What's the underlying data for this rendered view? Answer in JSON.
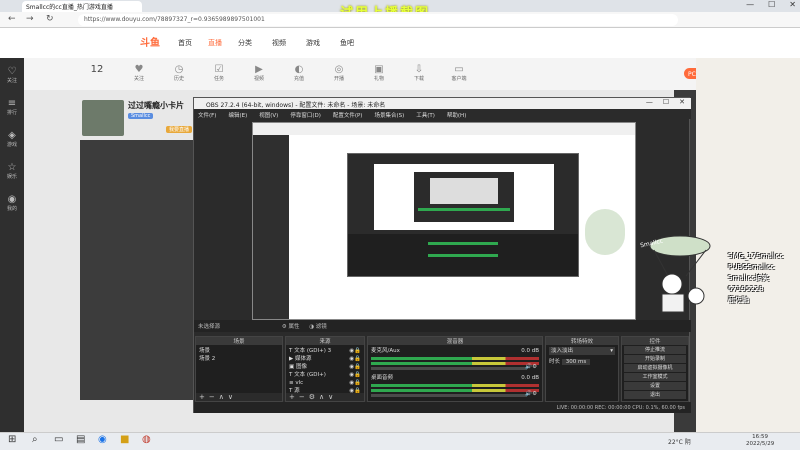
{
  "browser": {
    "tab_title": "Smallcc的cc直播_热门游戏直播",
    "url": "https://www.douyu.com/78897327_r=0.9365989897501001",
    "overlay_text": "试用上播截图"
  },
  "site": {
    "logo": "斗鱼",
    "nav": [
      "首页",
      "直播",
      "分类",
      "视频",
      "游戏",
      "鱼吧"
    ],
    "toolbar": [
      "12",
      "关注",
      "历史",
      "任务",
      "视频",
      "充值",
      "开播",
      "礼物",
      "下载",
      "客户端"
    ],
    "pc_client": "PC客户端",
    "room_title": "过过嘴瘾小卡片",
    "badges": [
      "Smallcc",
      "我要直播"
    ],
    "rail": [
      "关注",
      "排行",
      "游戏",
      "娱乐",
      "我的"
    ]
  },
  "obs": {
    "title": "OBS 27.2.4 (64-bit, windows) - 配置文件: 未命名 - 场景: 未命名",
    "menu": [
      "文件(F)",
      "编辑(E)",
      "视图(V)",
      "停靠窗口(D)",
      "配置文件(P)",
      "场景集合(S)",
      "工具(T)",
      "帮助(H)"
    ],
    "status_left": "未选择源",
    "status_props": "属性",
    "status_filter": "滤镜",
    "docks": {
      "scenes": {
        "title": "场景",
        "items": [
          "场景",
          "场景 2"
        ]
      },
      "sources": {
        "title": "来源",
        "items": [
          "文本 (GDI+) 3",
          "媒体源",
          "图像",
          "文本 (GDI+)",
          "vlc",
          "源"
        ]
      },
      "mixer": {
        "title": "混音器",
        "tracks": [
          {
            "name": "麦克风/Aux",
            "db": "0.0 dB"
          },
          {
            "name": "桌面音频",
            "db": "0.0 dB"
          }
        ]
      },
      "transitions": {
        "title": "转场特效",
        "type": "淡入淡出",
        "duration_label": "时长",
        "duration": "300 ms"
      },
      "controls": {
        "title": "控件",
        "buttons": [
          "停止推流",
          "开始录制",
          "启动虚拟摄像机",
          "工作室模式",
          "设置",
          "退出"
        ]
      }
    },
    "bottom": "LIVE: 00:00:00    REC: 00:00:00    CPU: 0.1%, 60.00 fps"
  },
  "streamer": {
    "lines": [
      "SMG_17Smallcc",
      "PUBGSmallcc",
      "Smallcc搞笑",
      "67195228",
      "鹿佐鼬"
    ],
    "sign": "Smallcc"
  },
  "taskbar": {
    "weather": "22°C 阴",
    "time": "16:59",
    "date": "2022/5/29"
  }
}
